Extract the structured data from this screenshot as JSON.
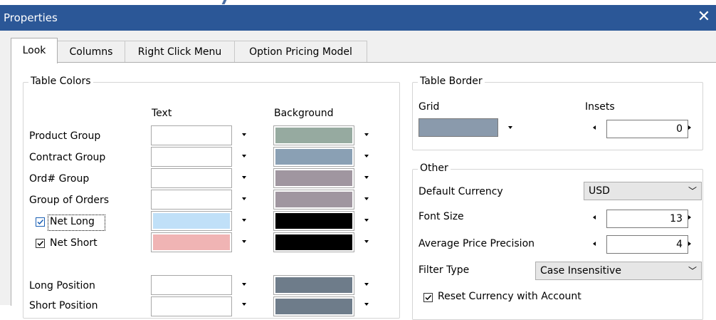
{
  "window": {
    "title": "Properties",
    "close_glyph": "✕"
  },
  "tabs": [
    {
      "label": "Look",
      "active": true
    },
    {
      "label": "Columns",
      "active": false
    },
    {
      "label": "Right Click Menu",
      "active": false
    },
    {
      "label": "Option Pricing Model",
      "active": false
    }
  ],
  "table_colors": {
    "title": "Table Colors",
    "col_text": "Text",
    "col_background": "Background",
    "rows": [
      {
        "label": "Product Group",
        "text_color": "#ffffff",
        "bg_color": "#96aaa0"
      },
      {
        "label": "Contract Group",
        "text_color": "#ffffff",
        "bg_color": "#8aa0b4"
      },
      {
        "label": "Ord# Group",
        "text_color": "#ffffff",
        "bg_color": "#a096a0"
      },
      {
        "label": "Group of Orders",
        "text_color": "#ffffff",
        "bg_color": "#a096a0"
      },
      {
        "label": "Net Long",
        "checked": true,
        "text_color": "#c0e0f8",
        "bg_color": "#000000"
      },
      {
        "label": "Net Short",
        "checked": true,
        "text_color": "#f0b4b4",
        "bg_color": "#000000"
      },
      {
        "label": "Long Position",
        "text_color": "#ffffff",
        "bg_color": "#6e7c8a"
      },
      {
        "label": "Short Position",
        "text_color": "#ffffff",
        "bg_color": "#6e7c8a"
      }
    ]
  },
  "table_border": {
    "title": "Table Border",
    "grid_label": "Grid",
    "grid_color": "#8a9aac",
    "insets_label": "Insets",
    "insets_value": "0"
  },
  "other": {
    "title": "Other",
    "default_currency_label": "Default Currency",
    "default_currency_value": "USD",
    "font_size_label": "Font Size",
    "font_size_value": "13",
    "avg_price_precision_label": "Average Price Precision",
    "avg_price_precision_value": "4",
    "filter_type_label": "Filter Type",
    "filter_type_value": "Case Insensitive",
    "reset_currency_label": "Reset Currency with Account",
    "reset_currency_checked": true
  }
}
